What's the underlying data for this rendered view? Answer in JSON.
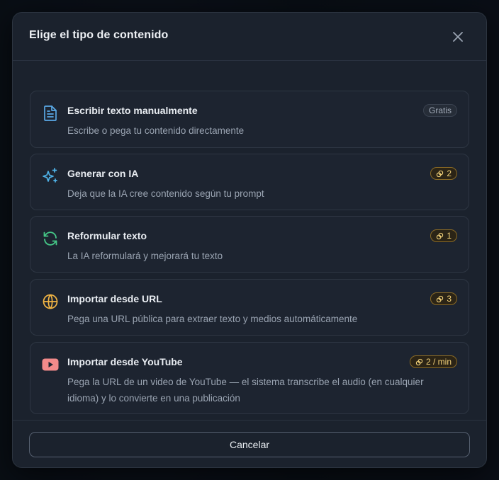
{
  "dialog": {
    "title": "Elige el tipo de contenido",
    "close_icon": "close-icon",
    "cancel_label": "Cancelar"
  },
  "options": [
    {
      "title": "Escribir texto manualmente",
      "description": "Escribe o pega tu contenido directamente",
      "badge": "Gratis",
      "badge_type": "free",
      "icon": "document-icon",
      "icon_color": "#5aa9e6"
    },
    {
      "title": "Generar con IA",
      "description": "Deja que la IA cree contenido según tu prompt",
      "badge": "2",
      "badge_type": "cost",
      "icon": "sparkles-icon",
      "icon_color": "#4fb3e8"
    },
    {
      "title": "Reformular texto",
      "description": "La IA reformulará y mejorará tu texto",
      "badge": "1",
      "badge_type": "cost",
      "icon": "refresh-icon",
      "icon_color": "#45c787"
    },
    {
      "title": "Importar desde URL",
      "description": "Pega una URL pública para extraer texto y medios automáticamente",
      "badge": "3",
      "badge_type": "cost",
      "icon": "globe-icon",
      "icon_color": "#f2b544"
    },
    {
      "title": "Importar desde YouTube",
      "description": "Pega la URL de un video de YouTube — el sistema transcribe el audio (en cualquier idioma) y lo convierte en una publicación",
      "badge": "2 / min",
      "badge_type": "cost",
      "icon": "youtube-icon",
      "icon_color": "#f27a7a"
    }
  ],
  "colors": {
    "badge_cost_text": "#f3d27a",
    "badge_cost_border": "#8a6a25",
    "modal_bg": "#1b222d"
  }
}
